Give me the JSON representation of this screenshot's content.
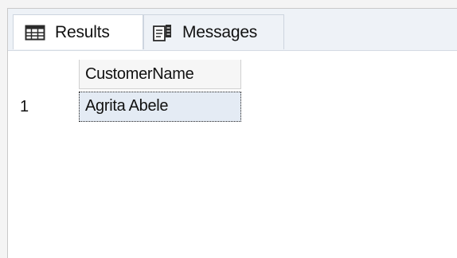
{
  "tabs": {
    "results": {
      "label": "Results",
      "icon": "grid-icon"
    },
    "messages": {
      "label": "Messages",
      "icon": "messages-icon"
    }
  },
  "grid": {
    "columns": [
      "CustomerName"
    ],
    "rows": [
      {
        "row_number": "1",
        "values": [
          "Agrita Abele"
        ]
      }
    ]
  }
}
